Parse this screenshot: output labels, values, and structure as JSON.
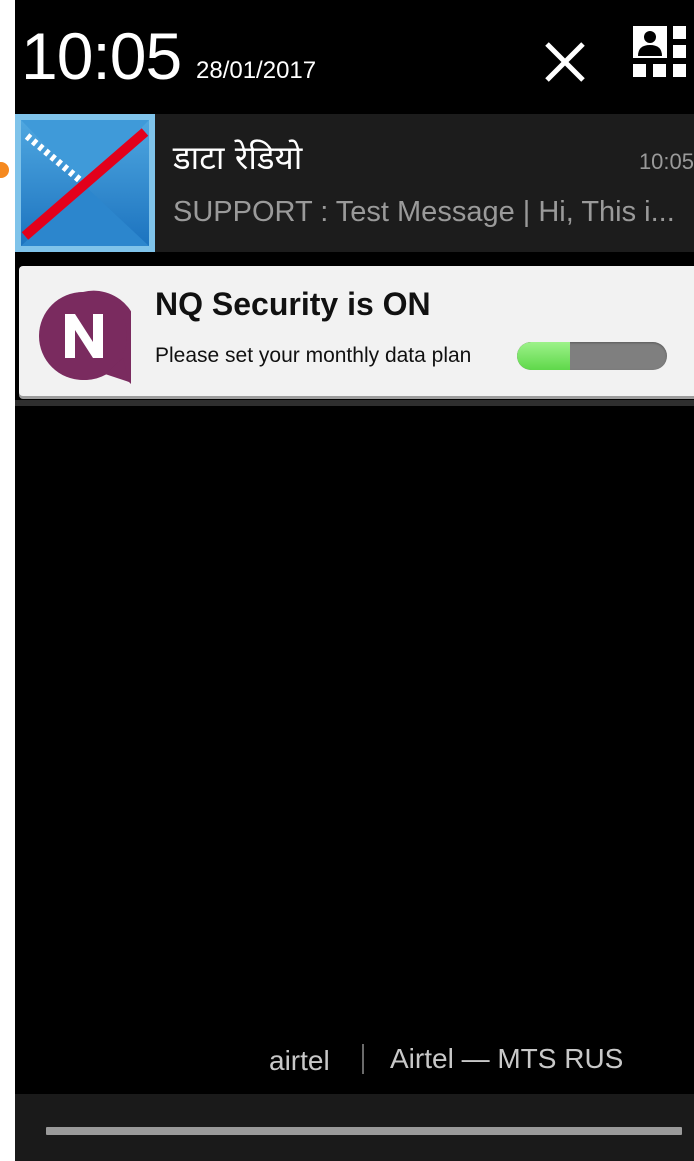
{
  "header": {
    "time": "10:05",
    "date": "28/01/2017"
  },
  "notifications": [
    {
      "app_icon": "crossed-envelope-icon",
      "title": "डाटा रेडियो",
      "time": "10:05",
      "text": "SUPPORT : Test Message | Hi, This i..."
    },
    {
      "app_icon": "nq-security-logo",
      "title": "NQ Security is ON",
      "text": "Please set your monthly data plan",
      "data_plan_progress": 0.35
    }
  ],
  "carrier": {
    "primary": "airtel",
    "secondary": "Airtel — MTS RUS"
  },
  "colors": {
    "accent_orange": "#f5891f",
    "nq_purple": "#7a2b5f",
    "progress_green": "#5fd84a"
  }
}
